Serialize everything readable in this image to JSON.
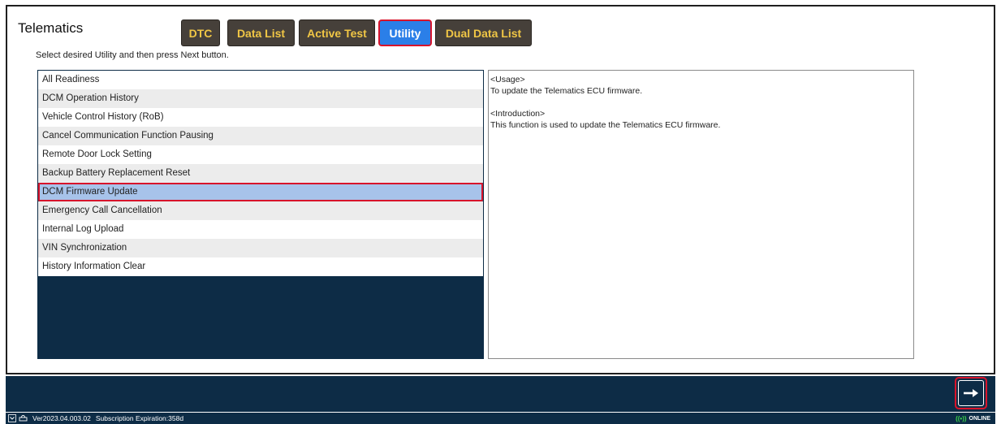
{
  "title": "Telematics",
  "instruction": "Select desired Utility and then press Next button.",
  "tabs": [
    {
      "label": "DTC"
    },
    {
      "label": "Data List"
    },
    {
      "label": "Active Test"
    },
    {
      "label": "Utility"
    },
    {
      "label": "Dual Data List"
    }
  ],
  "utility_list": [
    "All Readiness",
    "DCM Operation History",
    "Vehicle Control History (RoB)",
    "Cancel Communication Function Pausing",
    "Remote Door Lock Setting",
    "Backup Battery Replacement Reset",
    "DCM Firmware Update",
    "Emergency Call Cancellation",
    "Internal Log Upload",
    "VIN Synchronization",
    "History Information Clear"
  ],
  "selected_item": "DCM Firmware Update",
  "description": {
    "usage_heading": "<Usage>",
    "usage_text": "To update the Telematics ECU firmware.",
    "intro_heading": "<Introduction>",
    "intro_text": "This function is used to update the Telematics ECU firmware."
  },
  "next_button": {
    "icon": "arrow-right-icon"
  },
  "status": {
    "version": "Ver2023.04.003.02",
    "subscription": "Subscription Expiration:358d",
    "connection": "ONLINE"
  },
  "colors": {
    "tab_bg": "#46403a",
    "tab_text": "#f0c645",
    "active_tab_bg": "#2b7fe8",
    "highlight_border": "#d8142b",
    "panel_dark": "#0d2c46",
    "selected_row": "#a7c3ea",
    "online_green": "#3bd44a"
  }
}
